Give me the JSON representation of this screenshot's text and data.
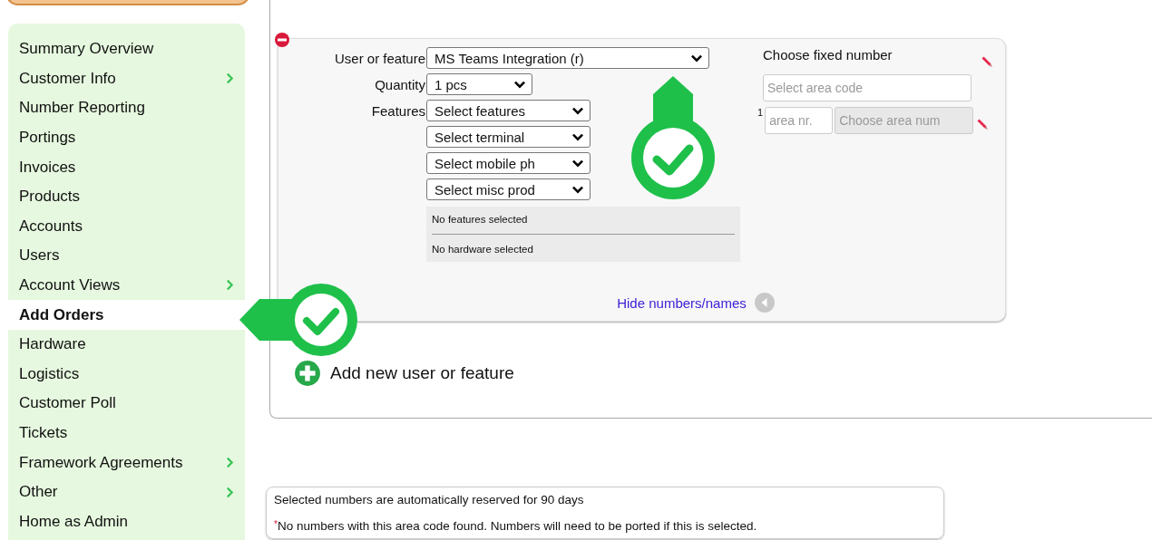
{
  "sidebar": {
    "items": [
      {
        "label": "Summary Overview",
        "selected": false,
        "has_submenu": false
      },
      {
        "label": "Customer Info",
        "selected": false,
        "has_submenu": true
      },
      {
        "label": "Number Reporting",
        "selected": false,
        "has_submenu": false
      },
      {
        "label": "Portings",
        "selected": false,
        "has_submenu": false
      },
      {
        "label": "Invoices",
        "selected": false,
        "has_submenu": false
      },
      {
        "label": "Products",
        "selected": false,
        "has_submenu": false
      },
      {
        "label": "Accounts",
        "selected": false,
        "has_submenu": false
      },
      {
        "label": "Users",
        "selected": false,
        "has_submenu": false
      },
      {
        "label": "Account Views",
        "selected": false,
        "has_submenu": true
      },
      {
        "label": "Add Orders",
        "selected": true,
        "has_submenu": false
      },
      {
        "label": "Hardware",
        "selected": false,
        "has_submenu": false
      },
      {
        "label": "Logistics",
        "selected": false,
        "has_submenu": false
      },
      {
        "label": "Customer Poll",
        "selected": false,
        "has_submenu": false
      },
      {
        "label": "Tickets",
        "selected": false,
        "has_submenu": false
      },
      {
        "label": "Framework Agreements",
        "selected": false,
        "has_submenu": true
      },
      {
        "label": "Other",
        "selected": false,
        "has_submenu": true
      },
      {
        "label": "Home as Admin",
        "selected": false,
        "has_submenu": false
      }
    ]
  },
  "order_card": {
    "rows": [
      {
        "label": "User or feature",
        "value": "MS Teams Integration (r)"
      },
      {
        "label": "Quantity",
        "value": "1 pcs"
      },
      {
        "label": "Features",
        "value": "Select features"
      },
      {
        "value": "Select terminal"
      },
      {
        "value": "Select mobile ph"
      },
      {
        "value": "Select misc prod"
      }
    ],
    "summary": [
      "No features selected",
      "No hardware selected"
    ],
    "fixed_number": {
      "title": "Choose fixed number",
      "area_code": {
        "placeholder": "Select area code"
      },
      "index": "1",
      "area_nr": {
        "placeholder": "area nr."
      },
      "area_number": {
        "placeholder": "Choose area num",
        "disabled": true
      }
    },
    "toggle_link": "Hide numbers/names"
  },
  "add_row": {
    "label": "Add new user or feature"
  },
  "notes": {
    "lines": [
      "Selected numbers are automatically reserved for 90 days",
      "No numbers with this area code found. Numbers will need to be ported if this is selected."
    ],
    "asterisk": "*"
  }
}
